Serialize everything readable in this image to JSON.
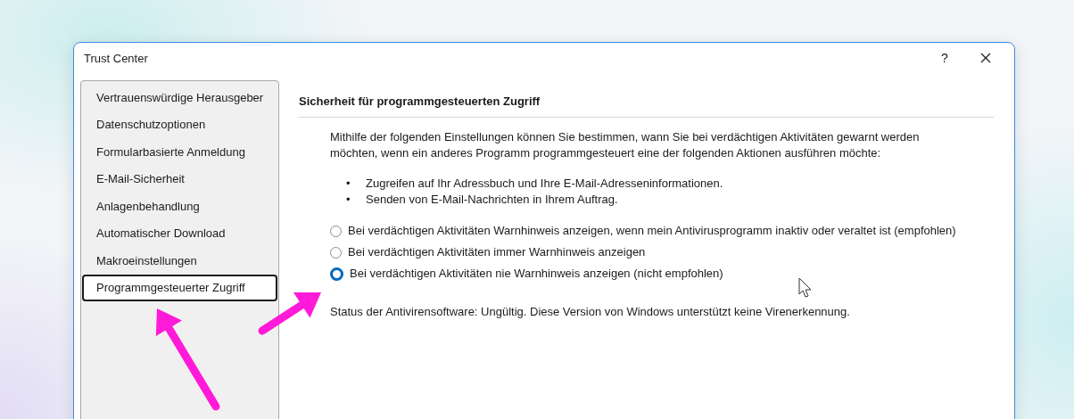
{
  "window": {
    "title": "Trust Center",
    "help_button": "?"
  },
  "sidebar": {
    "items": [
      {
        "label": "Vertrauenswürdige Herausgeber",
        "selected": false
      },
      {
        "label": "Datenschutzoptionen",
        "selected": false
      },
      {
        "label": "Formularbasierte Anmeldung",
        "selected": false
      },
      {
        "label": "E-Mail-Sicherheit",
        "selected": false
      },
      {
        "label": "Anlagenbehandlung",
        "selected": false
      },
      {
        "label": "Automatischer Download",
        "selected": false
      },
      {
        "label": "Makroeinstellungen",
        "selected": false
      },
      {
        "label": "Programmgesteuerter Zugriff",
        "selected": true
      }
    ]
  },
  "section": {
    "heading": "Sicherheit für programmgesteuerten Zugriff",
    "description": "Mithilfe der folgenden Einstellungen können Sie bestimmen, wann Sie bei verdächtigen Aktivitäten gewarnt werden möchten, wenn ein anderes Programm programmgesteuert eine der folgenden Aktionen ausführen möchte:",
    "actions": [
      {
        "marker": "•",
        "text": "Zugreifen auf Ihr Adressbuch und Ihre E-Mail-Adresseninformationen."
      },
      {
        "marker": "•",
        "text": "Senden von E-Mail-Nachrichten in Ihrem Auftrag."
      }
    ],
    "options": [
      {
        "label": "Bei verdächtigen Aktivitäten Warnhinweis anzeigen, wenn mein Antivirusprogramm inaktiv oder veraltet ist (empfohlen)",
        "selected": false
      },
      {
        "label": "Bei verdächtigen Aktivitäten immer Warnhinweis anzeigen",
        "selected": false
      },
      {
        "label": "Bei verdächtigen Aktivitäten nie Warnhinweis anzeigen (nicht empfohlen)",
        "selected": true
      }
    ],
    "status": "Status der Antivirensoftware: Ungültig. Diese Version von Windows unterstützt keine Virenerkennung."
  }
}
